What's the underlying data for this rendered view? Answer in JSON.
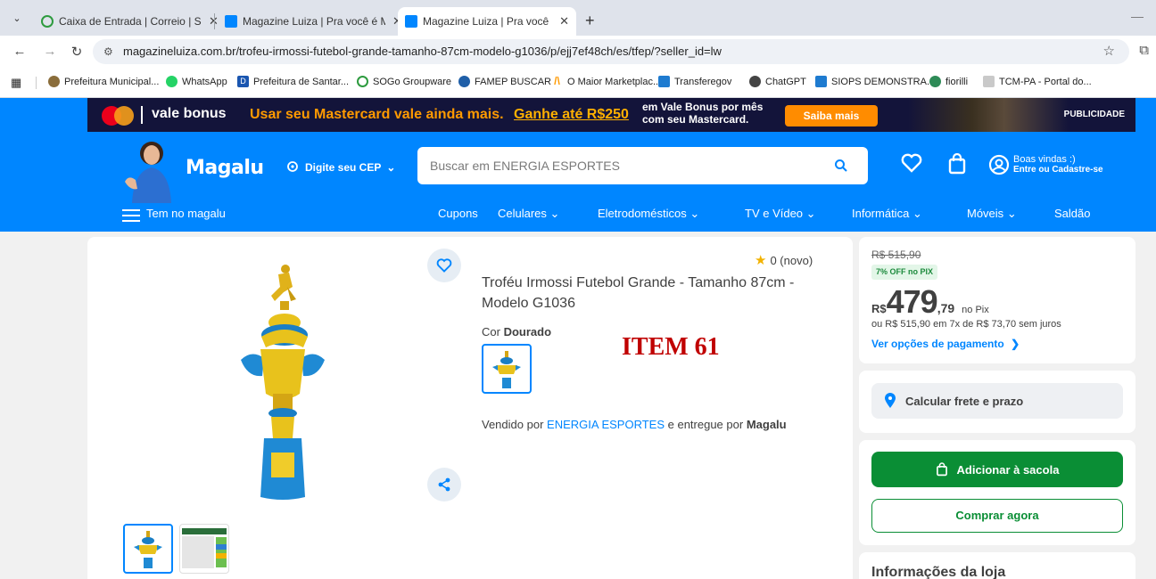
{
  "browser": {
    "tabs": [
      {
        "title": "Caixa de Entrada | Correio | SOGo",
        "active": false,
        "icon": "sogo-icon"
      },
      {
        "title": "Magazine Luiza | Pra você é Magalu",
        "active": false,
        "icon": "magalu-icon"
      },
      {
        "title": "Magazine Luiza | Pra você é Magalu",
        "active": true,
        "icon": "magalu-icon"
      }
    ],
    "url": "magazineluiza.com.br/trofeu-irmossi-futebol-grande-tamanho-87cm-modelo-g1036/p/ejj7ef48ch/es/tfep/?seller_id=lw",
    "bookmarks": [
      "Prefeitura Municipal...",
      "WhatsApp",
      "Prefeitura de Santar...",
      "SOGo Groupware",
      "FAMEP BUSCAR",
      "O Maior Marketplac...",
      "Transferegov",
      "ChatGPT",
      "SIOPS DEMONSTRA...",
      "fiorilli",
      "TCM-PA - Portal do..."
    ]
  },
  "promo": {
    "brand": "vale bonus",
    "line1": "Usar seu Mastercard vale ainda mais.",
    "line2": "Ganhe até R$250",
    "line3": "em Vale Bonus por mês com seu Mastercard.",
    "cta": "Saiba mais",
    "tag": "PUBLICIDADE"
  },
  "header": {
    "logo": "Magalu",
    "cep_label": "Digite seu CEP",
    "search_placeholder": "Buscar em ENERGIA ESPORTES",
    "welcome_line1": "Boas vindas :)",
    "welcome_line2": "Entre ou Cadastre-se"
  },
  "nav": {
    "menu_label": "Tem no magalu",
    "items": [
      "Cupons",
      "Celulares",
      "Eletrodomésticos",
      "TV e Vídeo",
      "Informática",
      "Móveis",
      "Saldão"
    ]
  },
  "product": {
    "rating": "0 (novo)",
    "title": "Troféu Irmossi Futebol Grande - Tamanho 87cm - Modelo G1036",
    "color_label": "Cor",
    "color_value": "Dourado",
    "annotation": "ITEM 61",
    "seller_prefix": "Vendido por",
    "seller_name": "ENERGIA ESPORTES",
    "seller_mid": "e entregue por",
    "deliverer": "Magalu"
  },
  "pricing": {
    "old_price": "R$ 515,90",
    "pix_discount": "7% OFF no PIX",
    "currency": "R$",
    "price_int": "479",
    "price_cents": ",79",
    "price_suffix": "no Pix",
    "installments": "ou R$ 515,90 em 7x de R$ 73,70 sem juros",
    "payment_options": "Ver opções de pagamento",
    "shipping": "Calcular frete e prazo",
    "add_to_bag": "Adicionar à sacola",
    "buy_now": "Comprar agora",
    "store_info": "Informações da loja"
  },
  "colors": {
    "brand_blue": "#0086ff",
    "buy_green": "#0a8e35",
    "promo_bg": "#13143a",
    "annotation_red": "#c00000"
  }
}
